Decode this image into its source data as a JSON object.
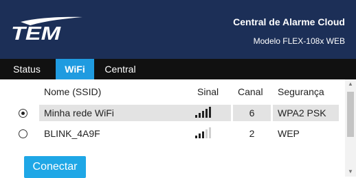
{
  "header": {
    "logo_text": "TEM",
    "title": "Central de Alarme Cloud",
    "subtitle": "Modelo FLEX-108x WEB"
  },
  "tabs": [
    {
      "label": "Status",
      "active": false
    },
    {
      "label": "WiFi",
      "active": true
    },
    {
      "label": "Central",
      "active": false
    }
  ],
  "table": {
    "columns": [
      "Nome (SSID)",
      "Sinal",
      "Canal",
      "Segurança"
    ],
    "rows": [
      {
        "selected": true,
        "ssid": "Minha rede WiFi",
        "signal": 5,
        "channel": "6",
        "security": "WPA2 PSK"
      },
      {
        "selected": false,
        "ssid": "BLINK_4A9F",
        "signal": 3,
        "channel": "2",
        "security": "WEP"
      }
    ],
    "signal_max": 5
  },
  "connect_button": {
    "label": "Conectar"
  },
  "colors": {
    "header_bg": "#1c2f57",
    "tab_bar_bg": "#111111",
    "tab_active_bg": "#1f9be0",
    "button_bg": "#1fa7e6",
    "selected_row_bg": "#e3e3e3",
    "signal_on": "#222222",
    "signal_off": "#cfcfcf"
  }
}
